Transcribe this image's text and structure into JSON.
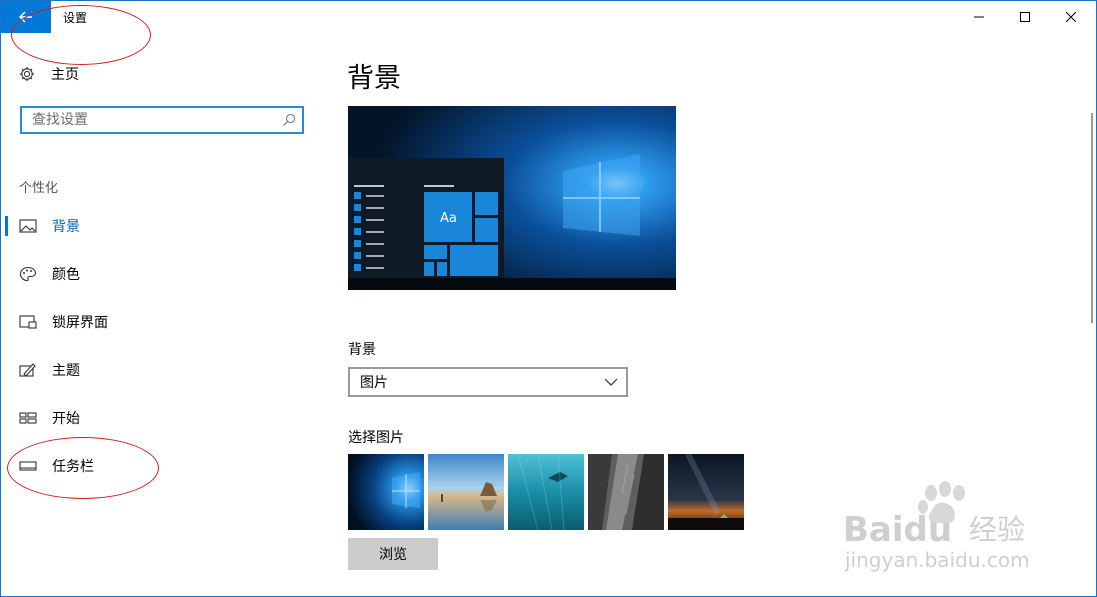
{
  "window": {
    "title": "设置"
  },
  "sidebar": {
    "home_label": "主页",
    "search_placeholder": "查找设置",
    "section_label": "个性化",
    "items": [
      {
        "label": "背景",
        "icon": "picture-icon",
        "active": true
      },
      {
        "label": "颜色",
        "icon": "palette-icon"
      },
      {
        "label": "锁屏界面",
        "icon": "lock-screen-icon"
      },
      {
        "label": "主题",
        "icon": "theme-icon"
      },
      {
        "label": "开始",
        "icon": "start-icon"
      },
      {
        "label": "任务栏",
        "icon": "taskbar-icon"
      }
    ]
  },
  "main": {
    "page_title": "背景",
    "preview_tile_text": "Aa",
    "background_label": "背景",
    "background_value": "图片",
    "choose_picture_label": "选择图片",
    "browse_label": "浏览"
  },
  "watermark": {
    "brand": "Baidu",
    "brand_cn": "经验",
    "url": "jingyan.baidu.com"
  },
  "colors": {
    "accent": "#0078d7",
    "annotation": "#d32020"
  }
}
